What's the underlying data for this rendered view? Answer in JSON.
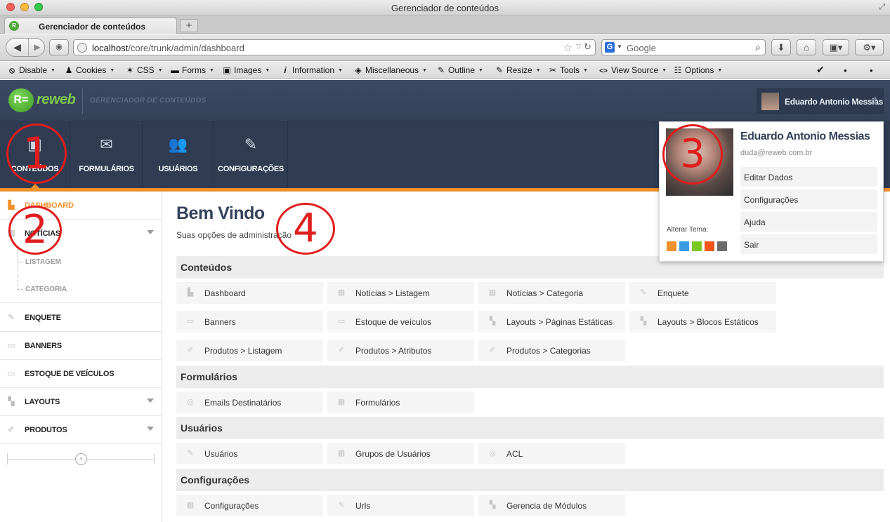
{
  "window": {
    "title": "Gerenciador de conteúdos"
  },
  "tab": {
    "title": "Gerenciador de conteúdos",
    "new_tab": "+"
  },
  "nav": {
    "url_host": "localhost",
    "url_path": "/core/trunk/admin/dashboard",
    "search_engine": "G",
    "search_placeholder": "Google"
  },
  "webdev_toolbar": [
    {
      "label": "Disable",
      "icon": "⦸"
    },
    {
      "label": "Cookies",
      "icon": "👤"
    },
    {
      "label": "CSS",
      "icon": "✎"
    },
    {
      "label": "Forms",
      "icon": "▬"
    },
    {
      "label": "Images",
      "icon": "▣"
    },
    {
      "label": "Information",
      "icon": "i"
    },
    {
      "label": "Miscellaneous",
      "icon": "◈"
    },
    {
      "label": "Outline",
      "icon": "✎"
    },
    {
      "label": "Resize",
      "icon": "✎"
    },
    {
      "label": "Tools",
      "icon": "✂"
    },
    {
      "label": "View Source",
      "icon": "<>"
    },
    {
      "label": "Options",
      "icon": "☰"
    }
  ],
  "header": {
    "brand": "reweb",
    "subtitle": "GERENCIADOR DE CONTEÚDOS",
    "user_name": "Eduardo Antonio Messias"
  },
  "modules": [
    {
      "label": "CONTEÚDOS",
      "icon": "monitor-icon"
    },
    {
      "label": "FORMULÁRIOS",
      "icon": "envelope-icon"
    },
    {
      "label": "USUÁRIOS",
      "icon": "users-icon"
    },
    {
      "label": "CONFIGURAÇÕES",
      "icon": "pencil-icon"
    }
  ],
  "sidebar": {
    "dashboard": "DASHBOARD",
    "noticias": "NOTÍCIAS",
    "listagem": "LISTAGEM",
    "categoria": "CATEGORIA",
    "enquete": "ENQUETE",
    "banners": "BANNERS",
    "estoque": "ESTOQUE DE VEÍCULOS",
    "layouts": "LAYOUTS",
    "produtos": "PRODUTOS"
  },
  "main": {
    "title": "Bem Vindo",
    "subtitle": "Suas opções de administração",
    "sections": {
      "conteudos": "Conteúdos",
      "formularios": "Formulários",
      "usuarios": "Usuários",
      "configuracoes": "Configurações"
    },
    "tiles": {
      "dashboard": "Dashboard",
      "noticias_listagem": "Notícias > Listagem",
      "noticias_categoria": "Notícias > Categoria",
      "enquete": "Enquete",
      "banners": "Banners",
      "estoque": "Estoque de veículos",
      "layouts_paginas": "Layouts > Páginas Estáticas",
      "layouts_blocos": "Layouts > Blocos Estáticos",
      "produtos_listagem": "Produtos > Listagem",
      "produtos_atributos": "Produtos > Atributos",
      "produtos_categorias": "Produtos > Categorias",
      "emails": "Emails Destinatários",
      "formularios": "Formulários",
      "usuarios": "Usuários",
      "grupos": "Grupos de Usuários",
      "acl": "ACL",
      "configuracoes": "Configurações",
      "urls": "Urls",
      "gerencia": "Gerencia de Módulos"
    }
  },
  "user_menu": {
    "name": "Eduardo Antonio Messias",
    "email": "duda@reweb.com.br",
    "links": [
      "Editar Dados",
      "Configurações",
      "Ajuda",
      "Sair"
    ],
    "theme_label": "Alterar Tema:",
    "theme_colors": [
      "#f0902b",
      "#3a9be0",
      "#7cc820",
      "#f2541b",
      "#6b6b6b"
    ]
  },
  "annotations": [
    "1",
    "2",
    "3",
    "4"
  ],
  "colors": {
    "accent": "#f0902b",
    "header": "#34425a",
    "annotation": "#e01d1d"
  }
}
